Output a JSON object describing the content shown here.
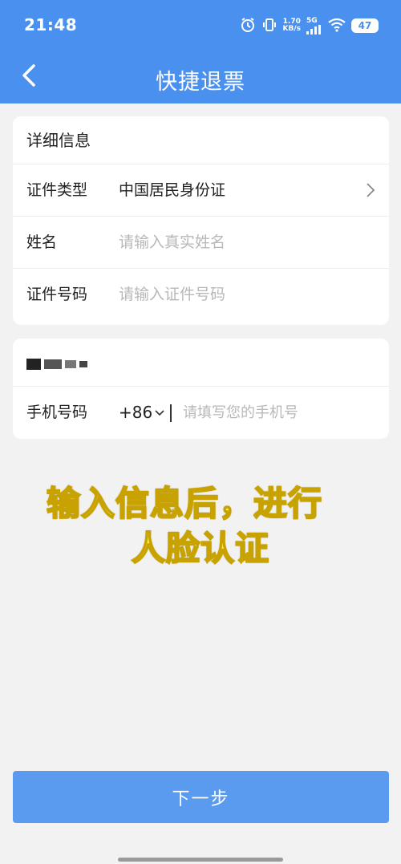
{
  "status_bar": {
    "time": "21:48",
    "network_speed_value": "1.70",
    "network_speed_unit": "KB/s",
    "network_type": "5G",
    "battery": "47",
    "icons": [
      "alarm-icon",
      "vibrate-icon",
      "signal-icon",
      "wifi-icon",
      "battery-icon"
    ]
  },
  "nav": {
    "title": "快捷退票",
    "back_icon": "chevron-left-icon"
  },
  "details_card": {
    "section_title": "详细信息",
    "id_type_label": "证件类型",
    "id_type_value": "中国居民身份证",
    "name_label": "姓名",
    "name_placeholder": "请输入真实姓名",
    "id_number_label": "证件号码",
    "id_number_placeholder": "请输入证件号码"
  },
  "phone_card": {
    "phone_label": "手机号码",
    "country_code": "+86",
    "phone_placeholder": "请填写您的手机号"
  },
  "caption": {
    "line1": "输入信息后，进行",
    "line2": "人脸认证"
  },
  "footer": {
    "next_label": "下一步"
  },
  "colors": {
    "header": "#4a90ee",
    "button": "#5a9bf0",
    "caption_fill": "#f7ef3a"
  }
}
